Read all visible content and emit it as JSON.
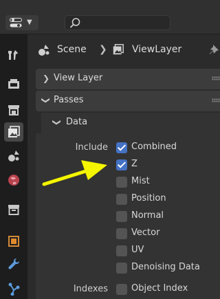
{
  "header": {
    "editor_icon": "editor-type-icon",
    "search_icon": "search-icon"
  },
  "breadcrumb": {
    "scene_label": "Scene",
    "view_layer_label": "ViewLayer"
  },
  "panels": {
    "view_layer": "View Layer",
    "passes": "Passes",
    "data": "Data"
  },
  "passes": {
    "include_label": "Include",
    "indexes_label": "Indexes",
    "items": [
      {
        "label": "Combined",
        "checked": true
      },
      {
        "label": "Z",
        "checked": true
      },
      {
        "label": "Mist",
        "checked": false
      },
      {
        "label": "Position",
        "checked": false
      },
      {
        "label": "Normal",
        "checked": false
      },
      {
        "label": "Vector",
        "checked": false
      },
      {
        "label": "UV",
        "checked": false
      },
      {
        "label": "Denoising Data",
        "checked": false
      }
    ],
    "index_items": [
      {
        "label": "Object Index",
        "checked": false
      }
    ]
  },
  "colors": {
    "accent_checkbox": "#4472c4",
    "annotation_arrow": "#f5f500"
  }
}
